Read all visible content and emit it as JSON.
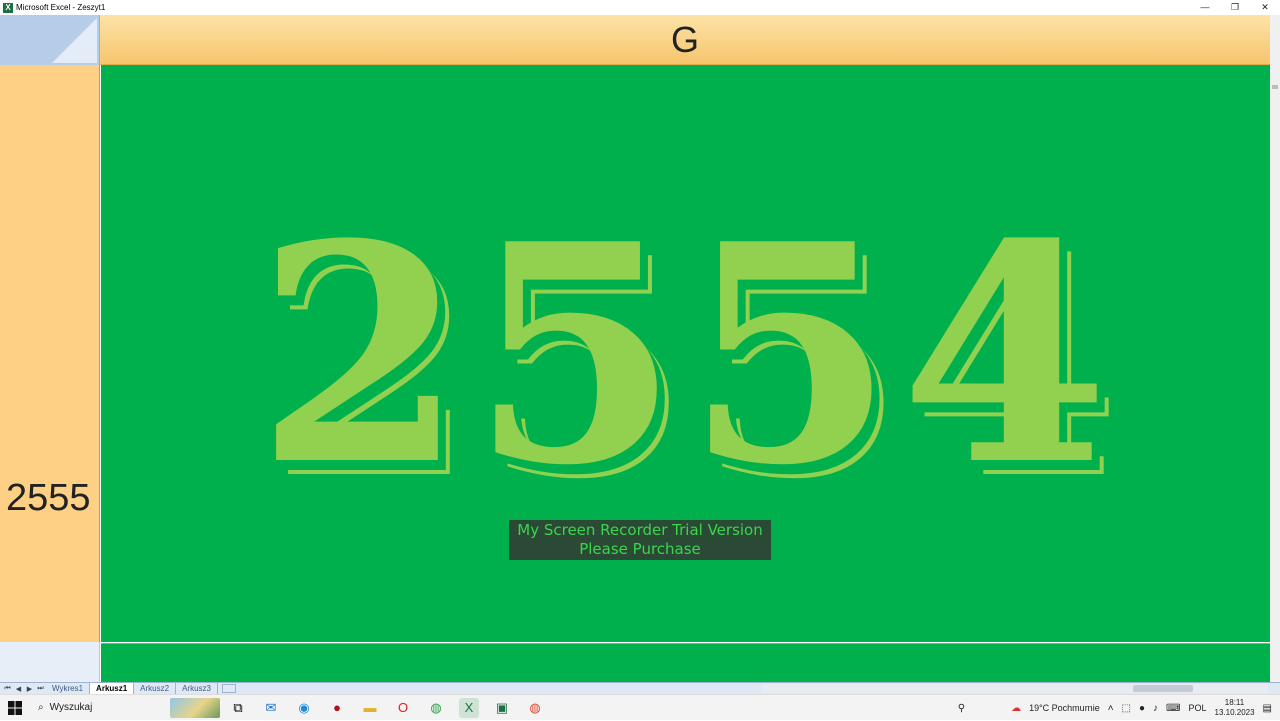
{
  "window": {
    "title": "Microsoft Excel - Zeszyt1",
    "minimize": "—",
    "restore": "❐",
    "close": "✕"
  },
  "sheet": {
    "column_header": "G",
    "row_header": "2555",
    "cell_value": "2554",
    "watermark_line1": "My Screen Recorder Trial Version",
    "watermark_line2": "Please Purchase",
    "tabs": [
      "Wykres1",
      "Arkusz1",
      "Arkusz2",
      "Arkusz3"
    ],
    "active_tab": "Arkusz1"
  },
  "colors": {
    "cell_fill": "#00b04c",
    "cell_text": "#92d050",
    "header_fill": "#fdd086"
  },
  "taskbar": {
    "search_placeholder": "Wyszukaj",
    "icons": [
      "task-view-icon",
      "mail-icon",
      "edge-icon",
      "app-red-icon",
      "file-explorer-icon",
      "opera-icon",
      "chrome-icon",
      "excel-icon",
      "app-excel2-icon",
      "chrome2-icon"
    ],
    "weather": "19°C  Pochmurnie",
    "language": "POL",
    "time": "18:11",
    "date": "13.10.2023"
  }
}
